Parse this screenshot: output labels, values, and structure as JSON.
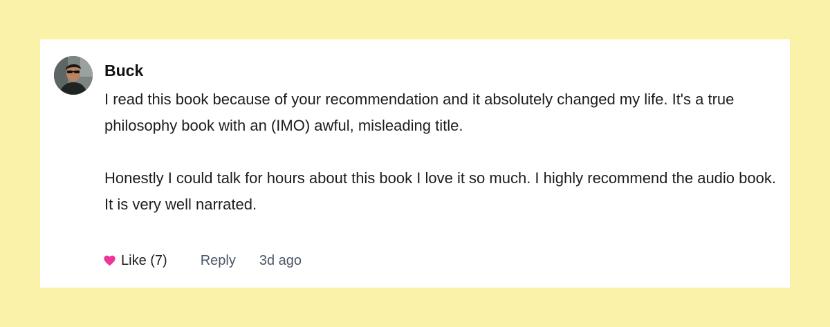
{
  "comment": {
    "author": "Buck",
    "paragraphs": [
      "I read this book because of your recommendation and it absolutely changed my life. It's a true philosophy book with an (IMO) awful, misleading title.",
      "Honestly I could talk for hours about this book I love it so much. I highly recommend the audio book. It is very well narrated."
    ],
    "avatar_icon": "user-avatar-photo"
  },
  "actions": {
    "like_label": "Like (7)",
    "like_icon": "heart-icon",
    "like_color": "#f0359a",
    "reply_label": "Reply",
    "timestamp": "3d ago"
  },
  "colors": {
    "background": "#fbf2a9",
    "card": "#ffffff",
    "muted_text": "#4a5566"
  }
}
